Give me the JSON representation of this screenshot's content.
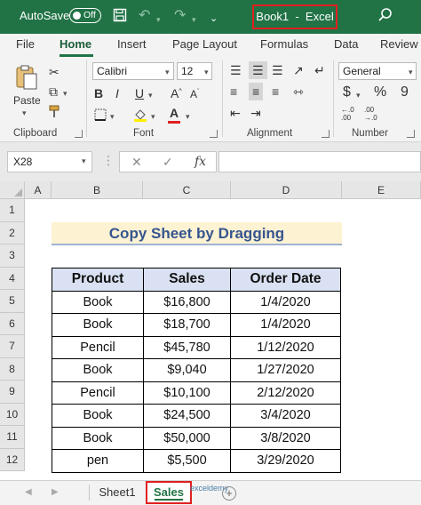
{
  "titlebar": {
    "autosave_label": "AutoSave",
    "autosave_state": "Off",
    "title": "Book1  -  Excel",
    "icons": [
      "save-icon",
      "undo-icon",
      "redo-icon",
      "customize-icon",
      "search-icon"
    ],
    "color": "#217346"
  },
  "menu": {
    "tabs": [
      "File",
      "Home",
      "Insert",
      "Page Layout",
      "Formulas",
      "Data",
      "Review"
    ],
    "active": "Home"
  },
  "ribbon": {
    "clipboard": {
      "label": "Clipboard",
      "paste_label": "Paste"
    },
    "font": {
      "label": "Font",
      "name": "Calibri",
      "size": "12",
      "bold": "B",
      "italic": "I",
      "underline": "U",
      "font_color_glyph": "A"
    },
    "alignment": {
      "label": "Alignment"
    },
    "number": {
      "label": "Number",
      "format": "General",
      "currency": "$",
      "percent": "%",
      "comma": "9"
    }
  },
  "formula_bar": {
    "name_box": "X28",
    "cancel": "✕",
    "enter": "✓",
    "fx": "fx",
    "value": ""
  },
  "sheet": {
    "columns": [
      "A",
      "B",
      "C",
      "D",
      "E"
    ],
    "rows": [
      "1",
      "2",
      "3",
      "4",
      "5",
      "6",
      "7",
      "8",
      "9",
      "10",
      "11",
      "12"
    ],
    "title": "Copy Sheet by Dragging",
    "headers": [
      "Product",
      "Sales",
      "Order Date"
    ],
    "data": [
      [
        "Book",
        "$16,800",
        "1/4/2020"
      ],
      [
        "Book",
        "$18,700",
        "1/4/2020"
      ],
      [
        "Pencil",
        "$45,780",
        "1/12/2020"
      ],
      [
        "Book",
        "$9,040",
        "1/27/2020"
      ],
      [
        "Pencil",
        "$10,100",
        "2/12/2020"
      ],
      [
        "Book",
        "$24,500",
        "3/4/2020"
      ],
      [
        "Book",
        "$50,000",
        "3/8/2020"
      ],
      [
        "pen",
        "$5,500",
        "3/29/2020"
      ]
    ]
  },
  "tabs": {
    "sheets": [
      "Sheet1",
      "Sales"
    ],
    "active": "Sales",
    "add": "+",
    "watermark": "exceldemy"
  }
}
